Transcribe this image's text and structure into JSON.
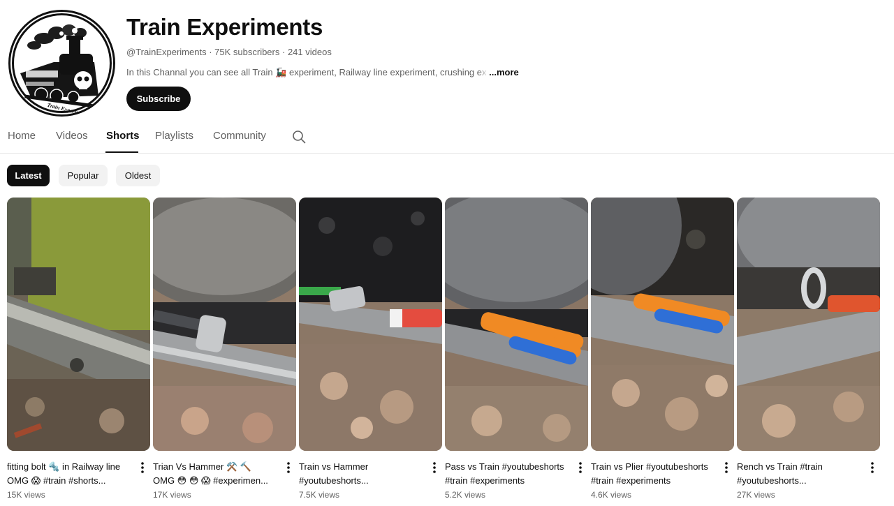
{
  "channel": {
    "name": "Train Experiments",
    "handle": "@TrainExperiments",
    "subscribers": "75K subscribers",
    "videos": "241 videos",
    "separator": " · ",
    "description": "In this Channal you can see all Train 🚂  experiment, Railway line experiment, crushing",
    "description_fade": " ex",
    "more": "...more",
    "subscribe_label": "Subscribe"
  },
  "tabs": [
    {
      "label": "Home"
    },
    {
      "label": "Videos"
    },
    {
      "label": "Shorts",
      "active": true
    },
    {
      "label": "Playlists"
    },
    {
      "label": "Community"
    }
  ],
  "chips": [
    {
      "label": "Latest",
      "active": true
    },
    {
      "label": "Popular"
    },
    {
      "label": "Oldest"
    }
  ],
  "shorts": [
    {
      "title1": "fitting bolt 🔩 in Railway line",
      "title2": "OMG 😱 #train #shorts...",
      "views": "15K views"
    },
    {
      "title1": "Trian Vs Hammer ⚒️ 🔨",
      "title2": "OMG 😳 😳 😱 #experimen...",
      "views": "17K views"
    },
    {
      "title1": "Train vs Hammer",
      "title2": "#youtubeshorts...",
      "views": "7.5K views"
    },
    {
      "title1": "Pass vs Train #youtubeshorts",
      "title2": "#train #experiments",
      "views": "5.2K views"
    },
    {
      "title1": "Train vs Plier #youtubeshorts",
      "title2": "#train #experiments",
      "views": "4.6K views"
    },
    {
      "title1": "Rench vs Train #train",
      "title2": "#youtubeshorts...",
      "views": "27K views"
    }
  ],
  "logo_text": "Train Experiments",
  "colors": {
    "accent": "#0f0f0f",
    "secondary_text": "#606060",
    "chip_bg": "#f2f2f2"
  }
}
